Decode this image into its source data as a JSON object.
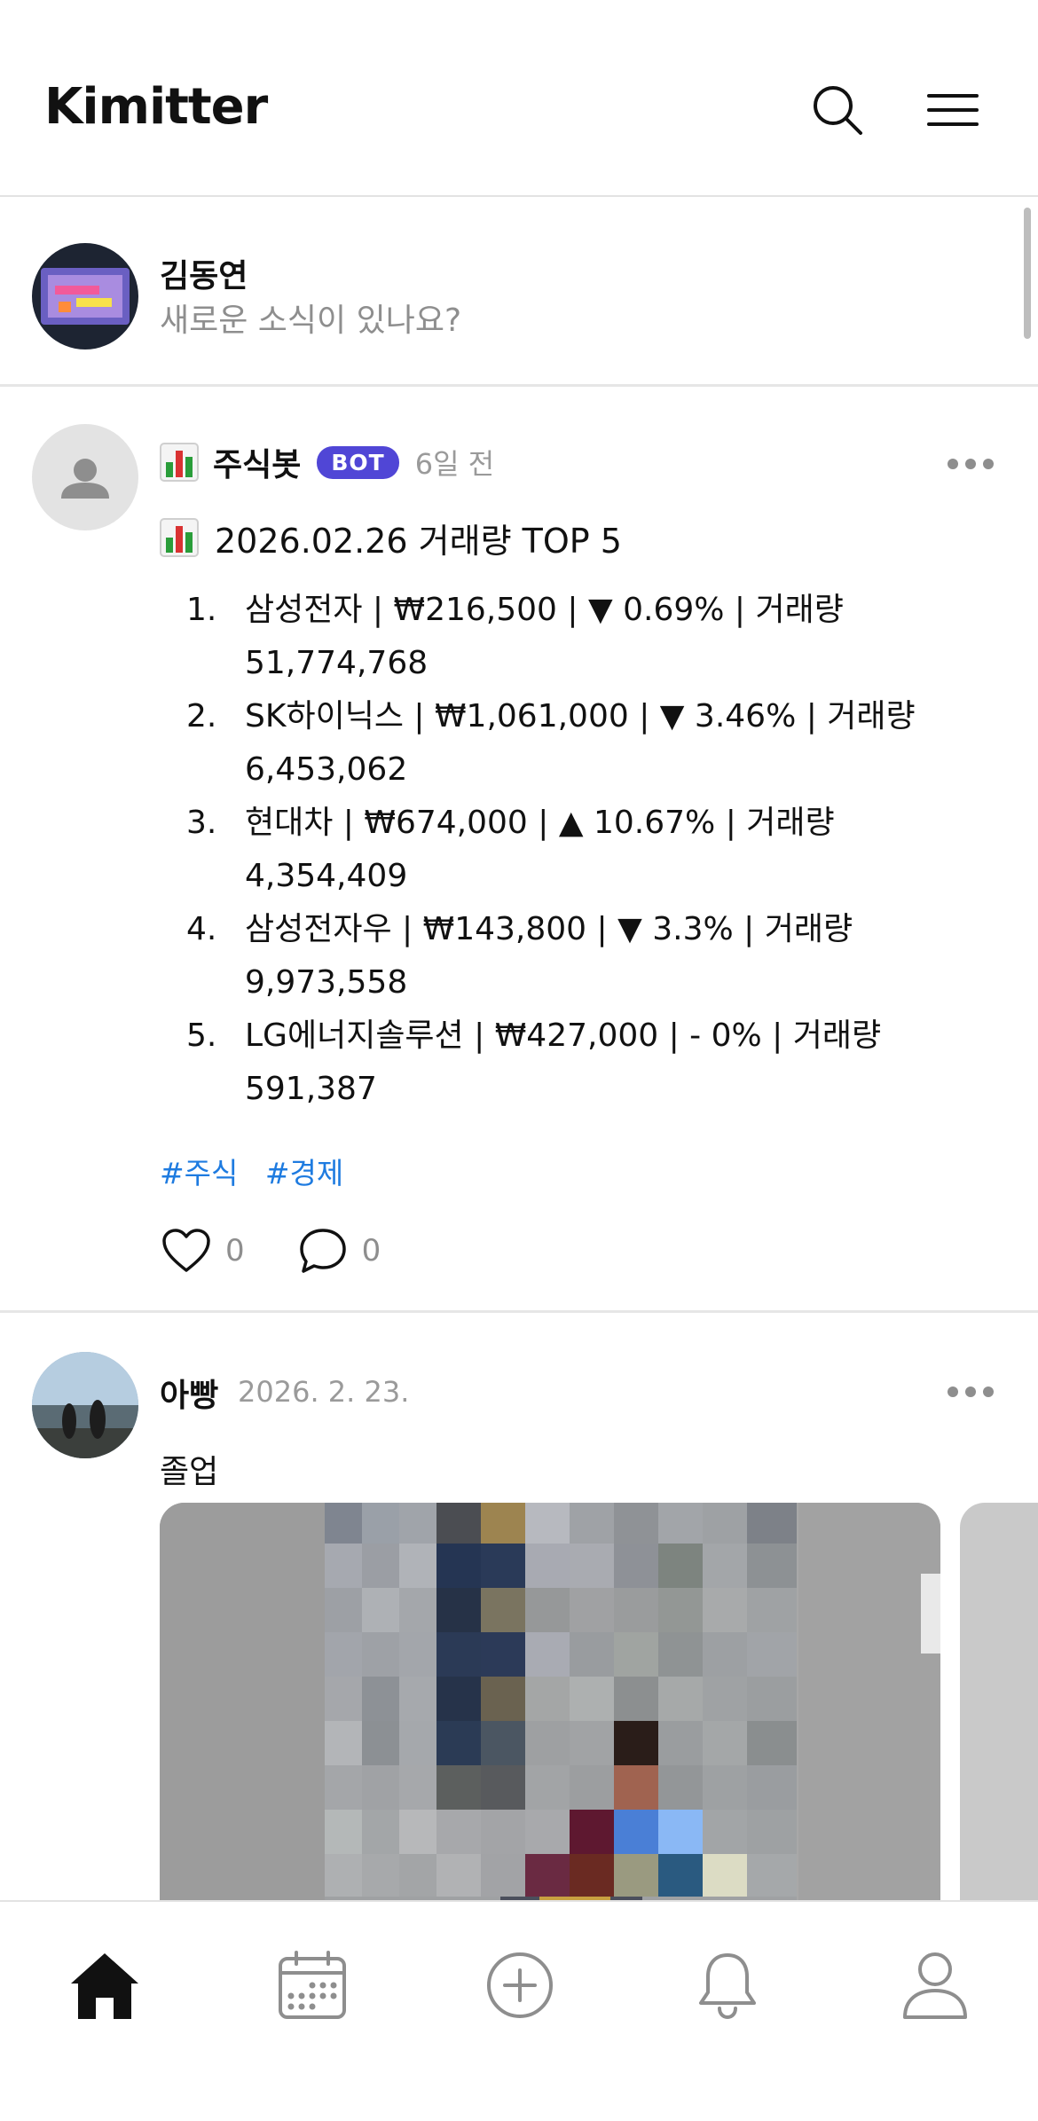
{
  "app": {
    "title": "Kimitter"
  },
  "composer": {
    "user_name": "김동연",
    "placeholder": "새로운 소식이 있나요?"
  },
  "posts": [
    {
      "author": "주식봇",
      "badge": "BOT",
      "time": "6일 전",
      "title": "2026.02.26 거래량 TOP 5",
      "items": [
        {
          "num": "1.",
          "line1": "삼성전자 | ₩216,500 | ▼ 0.69% | 거래량",
          "line2": "51,774,768"
        },
        {
          "num": "2.",
          "line1": "SK하이닉스 | ₩1,061,000 | ▼ 3.46% | 거래량",
          "line2": "6,453,062"
        },
        {
          "num": "3.",
          "line1": "현대차 | ₩674,000 | ▲ 10.67% | 거래량",
          "line2": "4,354,409"
        },
        {
          "num": "4.",
          "line1": "삼성전자우 | ₩143,800 | ▼ 3.3% | 거래량",
          "line2": "9,973,558"
        },
        {
          "num": "5.",
          "line1": "LG에너지솔루션 | ₩427,000 | - 0% | 거래량",
          "line2": "591,387"
        }
      ],
      "tags": [
        "#주식",
        "#경제"
      ],
      "likes": "0",
      "comments": "0"
    },
    {
      "author": "아빵",
      "time": "2026. 2. 23.",
      "text": "졸업"
    }
  ],
  "colors": {
    "bot_badge": "#5046d6",
    "hashtag": "#1e7be0",
    "muted": "#8e8e8e"
  },
  "icons": {
    "header": [
      "search-icon",
      "menu-icon"
    ],
    "tabs": [
      "home-icon",
      "calendar-icon",
      "add-circle-icon",
      "bell-icon",
      "profile-icon"
    ]
  }
}
